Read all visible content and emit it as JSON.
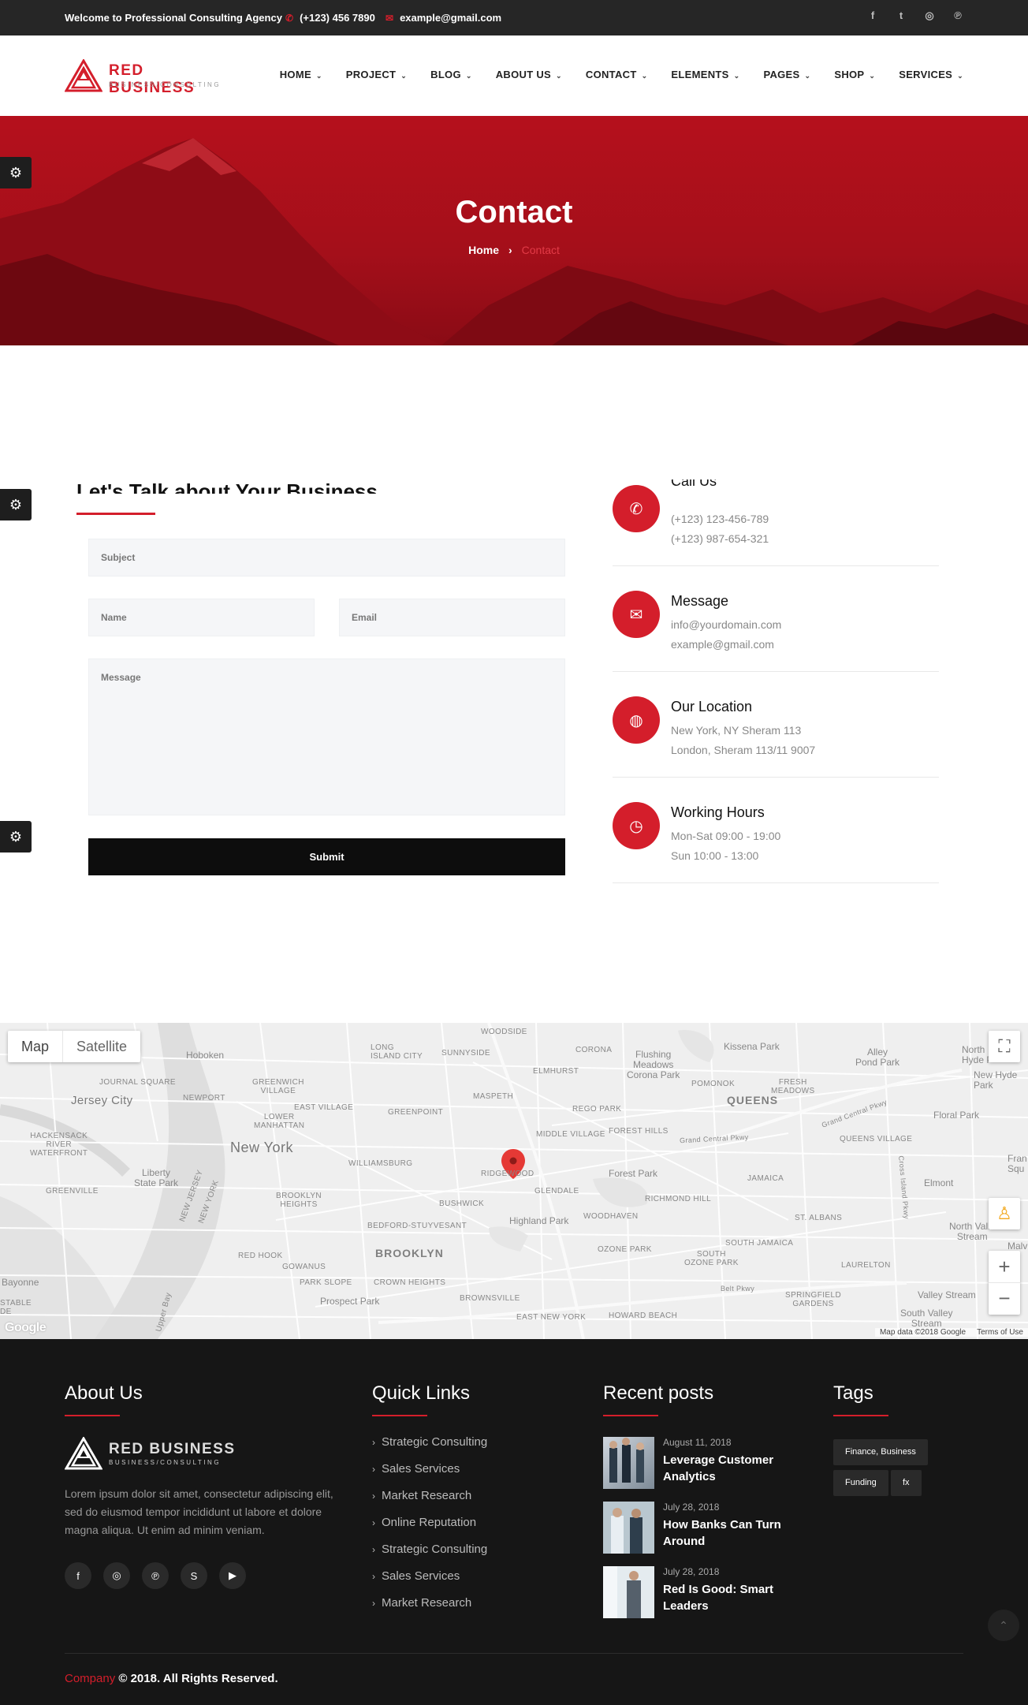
{
  "topbar": {
    "welcome": "Welcome to Professional Consulting Agency",
    "phone": "(+123) 456 7890",
    "email": "example@gmail.com",
    "socials": [
      "facebook-icon",
      "twitter-icon",
      "instagram-icon",
      "pinterest-icon"
    ]
  },
  "brand": {
    "name": "RED BUSINESS",
    "tagline": "BUSINESS/CONSULTING",
    "accent": "#d41e2b"
  },
  "nav": {
    "items": [
      "HOME",
      "PROJECT",
      "BLOG",
      "ABOUT US",
      "CONTACT",
      "ELEMENTS",
      "PAGES",
      "SHOP",
      "SERVICES"
    ]
  },
  "hero": {
    "title": "Contact",
    "crumb_home": "Home",
    "crumb_current": "Contact"
  },
  "form": {
    "title": "Let's Talk about Your Business",
    "subject_placeholder": "Subject",
    "name_placeholder": "Name",
    "email_placeholder": "Email",
    "message_placeholder": "Message",
    "submit_label": "Submit"
  },
  "info": [
    {
      "title": "Call Us",
      "line1": "(+123) 123-456-789",
      "line2": "(+123) 987-654-321",
      "icon": "phone-icon"
    },
    {
      "title": "Message",
      "line1": "info@yourdomain.com",
      "line2": "example@gmail.com",
      "icon": "envelope-icon"
    },
    {
      "title": "Our Location",
      "line1": "New York, NY Sheram 113",
      "line2": "London, Sheram 113/11 9007",
      "icon": "globe-icon"
    },
    {
      "title": "Working Hours",
      "line1": "Mon-Sat 09:00 - 19:00",
      "line2": "Sun 10:00 - 13:00",
      "icon": "clock-icon"
    }
  ],
  "map": {
    "type_map": "Map",
    "type_satellite": "Satellite",
    "google": "Google",
    "map_data": "Map data ©2018 Google",
    "terms": "Terms of Use",
    "labels": {
      "woodside": "WOODSIDE",
      "hoboken": "Hoboken",
      "long_island_city": "LONG\nISLAND CITY",
      "sunnyside": "SUNNYSIDE",
      "corona": "CORONA",
      "flushing_meadows": "Flushing\nMeadows\nCorona Park",
      "kissena": "Kissena Park",
      "alley_pond": "Alley\nPond Park",
      "north_hyde": "North\nHyde P",
      "new_hyde": "New Hyde\nPark",
      "journal_square": "JOURNAL SQUARE",
      "greenwich": "GREENWICH\nVILLAGE",
      "elmhurst": "ELMHURST",
      "pomonok": "POMONOK",
      "fresh_meadows": "FRESH\nMEADOWS",
      "jersey_city": "Jersey City",
      "newport": "NEWPORT",
      "east_village": "EAST VILLAGE",
      "maspeth": "MASPETH",
      "queens": "QUEENS",
      "lower_manhattan": "LOWER\nMANHATTAN",
      "greenpoint": "GREENPOINT",
      "rego_park": "REGO PARK",
      "floral_park": "Floral Park",
      "hackensack": "HACKENSACK\nRIVER\nWATERFRONT",
      "new_york": "New York",
      "middle_village": "MIDDLE VILLAGE",
      "forest_hills": "FOREST HILLS",
      "grand_central": "Grand Central Pkwy",
      "queens_village": "QUEENS VILLAGE",
      "williamsburg": "WILLIAMSBURG",
      "ridgewood": "RIDGEWOOD",
      "liberty": "Liberty\nState Park",
      "forest_park": "Forest Park",
      "jamaica": "JAMAICA",
      "elmont": "Elmont",
      "greenville": "GREENVILLE",
      "brooklyn_heights": "BROOKLYN\nHEIGHTS",
      "bushwick": "BUSHWICK",
      "glendale": "GLENDALE",
      "richmond_hill": "RICHMOND HILL",
      "highland_park": "Highland Park",
      "woodhaven": "WOODHAVEN",
      "st_albans": "ST. ALBANS",
      "north_valley": "North Valle\nStream",
      "bedford": "BEDFORD-STUYVESANT",
      "red_hook": "RED HOOK",
      "brooklyn": "BROOKLYN",
      "ozone_park": "OZONE PARK",
      "south_jamaica": "SOUTH JAMAICA",
      "south_ozone": "SOUTH\nOZONE PARK",
      "laurelton": "LAURELTON",
      "gowanus": "GOWANUS",
      "bayonne": "Bayonne",
      "park_slope": "PARK SLOPE",
      "crown_heights": "CROWN HEIGHTS",
      "prospect": "Prospect Park",
      "brownsville": "BROWNSVILLE",
      "springfield": "SPRINGFIELD\nGARDENS",
      "valley_stream": "Valley Stream",
      "south_valley": "South Valley\nStream",
      "stable": "STABLE\nDE",
      "east_ny": "EAST NEW YORK",
      "howard_beach": "HOWARD BEACH",
      "nj": "NEW JERSEY",
      "ny": "NEW YORK",
      "belt": "Belt Pkwy",
      "upper_bay": "Upper Bay",
      "cross_island": "Cross Island Pkwy",
      "grand_central2": "Grand Central Pkwy",
      "fran": "Fran\nSqu",
      "malv": "Malv"
    }
  },
  "footer": {
    "about_title": "About Us",
    "about_text": "Lorem ipsum dolor sit amet, consectetur adipiscing elit, sed do eiusmod tempor incididunt ut labore et dolore magna aliqua. Ut enim ad minim veniam.",
    "socials": [
      "facebook-icon",
      "instagram-icon",
      "pinterest-icon",
      "skype-icon",
      "youtube-icon"
    ],
    "quick_title": "Quick Links",
    "quick_links": [
      "Strategic Consulting",
      "Sales Services",
      "Market Research",
      "Online Reputation",
      "Strategic Consulting",
      "Sales Services",
      "Market Research"
    ],
    "posts_title": "Recent posts",
    "posts": [
      {
        "date": "August 11, 2018",
        "title": "Leverage Customer Analytics"
      },
      {
        "date": "July 28, 2018",
        "title": "How Banks Can Turn Around"
      },
      {
        "date": "July 28, 2018",
        "title": "Red Is Good: Smart Leaders"
      }
    ],
    "tags_title": "Tags",
    "tags": [
      "Finance, Business",
      "Funding",
      "fx"
    ],
    "copy_company": "Company",
    "copy_rest": " © 2018. All Rights Reserved."
  }
}
